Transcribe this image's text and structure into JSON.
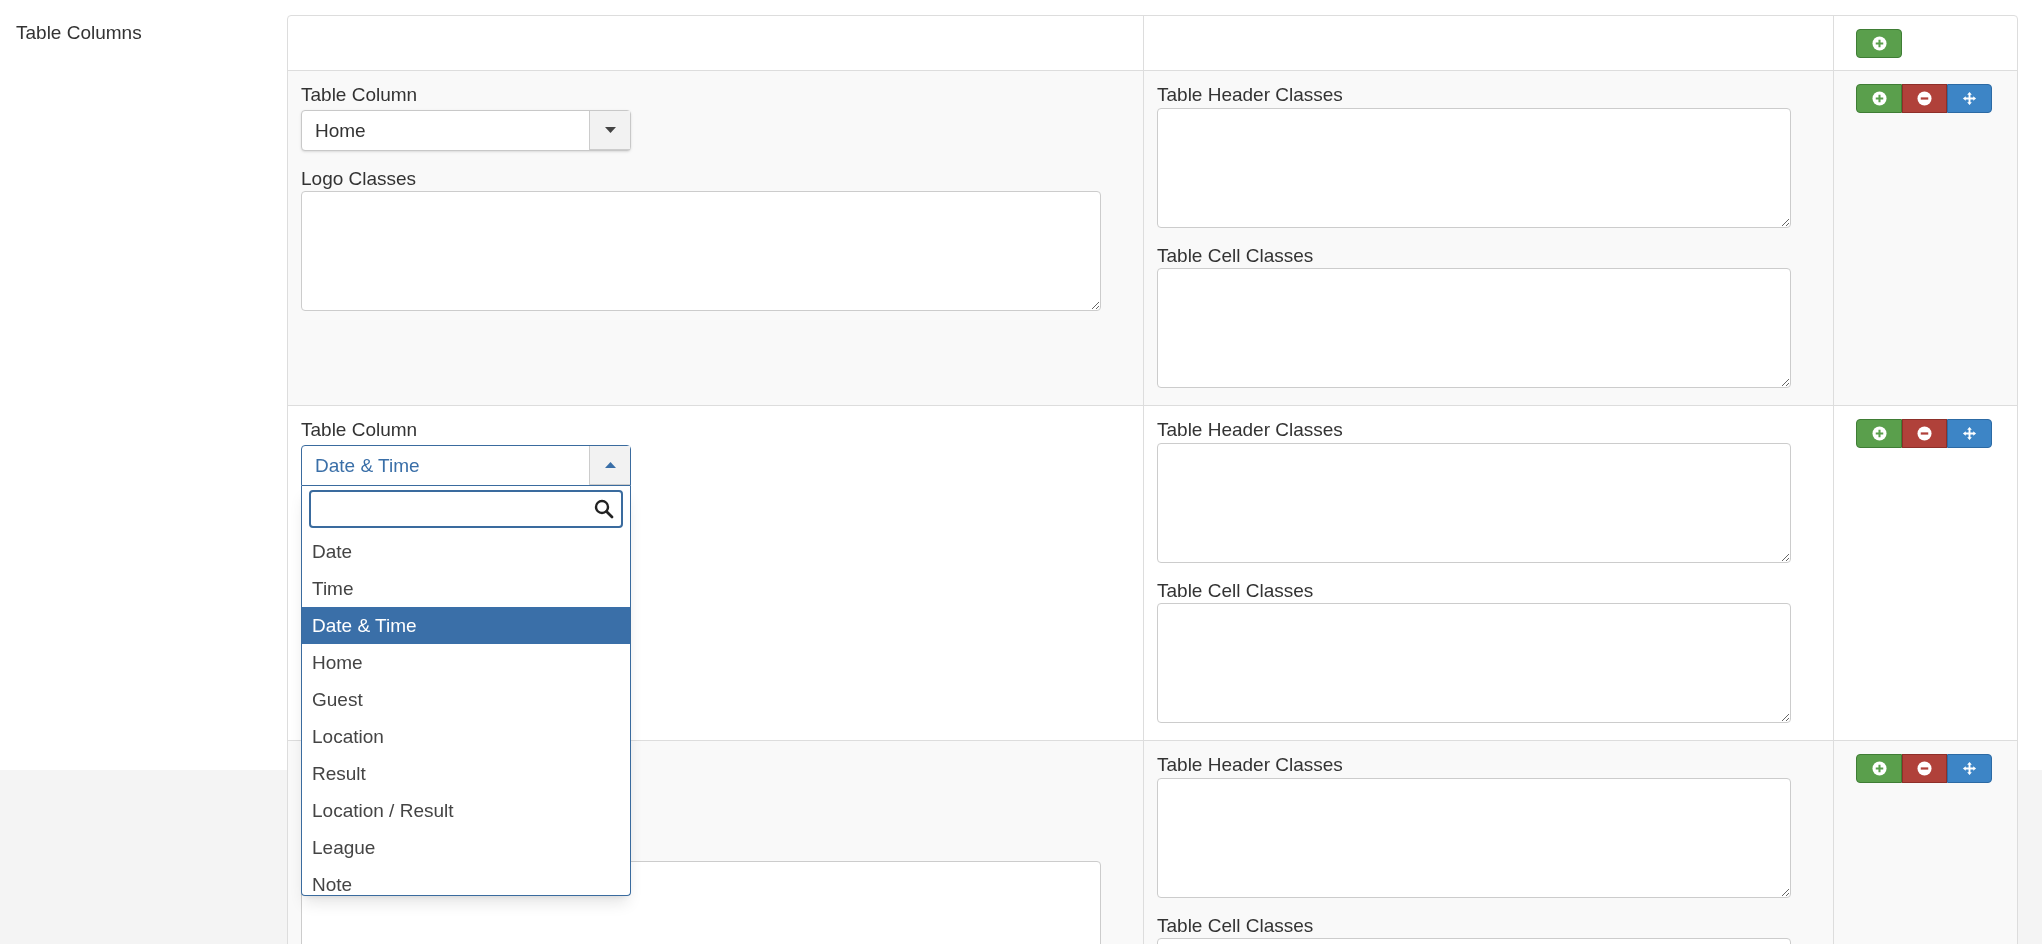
{
  "section_label": "Table Columns",
  "rows": [
    {
      "column": {
        "label": "Table Column",
        "value": "Home",
        "open": false
      },
      "logo": {
        "label": "Logo Classes",
        "textarea": true
      },
      "header": {
        "label": "Table Header Classes"
      },
      "cell": {
        "label": "Table Cell Classes"
      }
    },
    {
      "column": {
        "label": "Table Column",
        "value": "Date & Time",
        "open": true,
        "options": [
          {
            "label": "Date",
            "selected": false
          },
          {
            "label": "Time",
            "selected": false
          },
          {
            "label": "Date & Time",
            "selected": true
          },
          {
            "label": "Home",
            "selected": false
          },
          {
            "label": "Guest",
            "selected": false
          },
          {
            "label": "Location",
            "selected": false
          },
          {
            "label": "Result",
            "selected": false
          },
          {
            "label": "Location / Result",
            "selected": false
          },
          {
            "label": "League",
            "selected": false
          },
          {
            "label": "Note",
            "selected": false
          }
        ]
      },
      "header": {
        "label": "Table Header Classes"
      },
      "cell": {
        "label": "Table Cell Classes"
      }
    },
    {
      "logo": {
        "textarea": true
      },
      "header": {
        "label": "Table Header Classes"
      },
      "cell": {
        "label": "Table Cell Classes"
      }
    }
  ]
}
